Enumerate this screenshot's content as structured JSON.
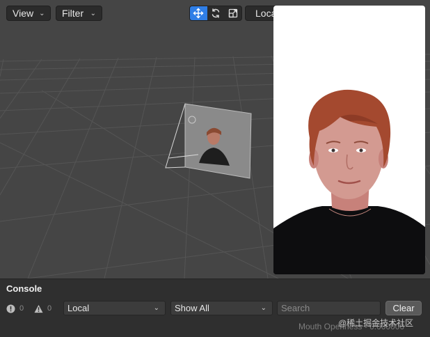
{
  "toolbar": {
    "view_label": "View",
    "filter_label": "Filter",
    "space_label": "Local",
    "tools": [
      {
        "name": "move-icon",
        "active": true
      },
      {
        "name": "rotate-icon",
        "active": false
      },
      {
        "name": "scale-icon",
        "active": false
      }
    ]
  },
  "console": {
    "title": "Console",
    "error_count": "0",
    "warning_count": "0",
    "source_select": "Local",
    "level_select": "Show All",
    "search_placeholder": "Search",
    "clear_label": "Clear"
  },
  "status": {
    "label": "Mouth Openness",
    "value": "0.000000"
  },
  "watermark": "@稀土掘金技术社区",
  "colors": {
    "accent": "#2f7ee6",
    "viewport": "#454545",
    "panel": "#2f2f2f"
  }
}
